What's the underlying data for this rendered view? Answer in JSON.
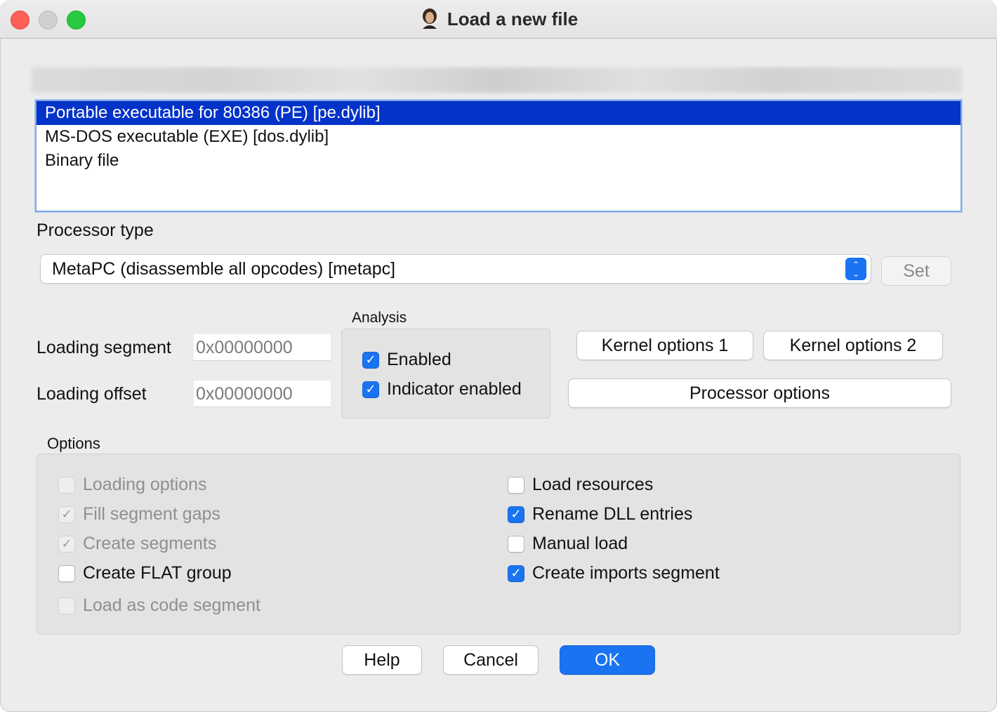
{
  "window": {
    "title": "Load a new file"
  },
  "loaders": [
    {
      "label": "Portable executable for 80386 (PE) [pe.dylib]",
      "selected": true
    },
    {
      "label": "MS-DOS executable (EXE) [dos.dylib]",
      "selected": false
    },
    {
      "label": "Binary file",
      "selected": false
    }
  ],
  "processor": {
    "label": "Processor type",
    "selected": "MetaPC (disassemble all opcodes) [metapc]",
    "set_label": "Set"
  },
  "loading": {
    "segment_label": "Loading segment",
    "segment_value": "0x00000000",
    "offset_label": "Loading offset",
    "offset_value": "0x00000000"
  },
  "analysis": {
    "title": "Analysis",
    "enabled_label": "Enabled",
    "indicator_label": "Indicator enabled"
  },
  "buttons": {
    "kernel1": "Kernel options 1",
    "kernel2": "Kernel options 2",
    "processor_options": "Processor options",
    "help": "Help",
    "cancel": "Cancel",
    "ok": "OK"
  },
  "options": {
    "title": "Options",
    "left": [
      {
        "label": "Loading options",
        "checked": false,
        "disabled": true
      },
      {
        "label": "Fill segment gaps",
        "checked": true,
        "disabled": true
      },
      {
        "label": "Create segments",
        "checked": true,
        "disabled": true
      },
      {
        "label": "Create FLAT group",
        "checked": false,
        "disabled": false
      },
      {
        "label": "Load as code segment",
        "checked": false,
        "disabled": true
      }
    ],
    "right": [
      {
        "label": "Load resources",
        "checked": false,
        "disabled": false
      },
      {
        "label": "Rename DLL entries",
        "checked": true,
        "disabled": false
      },
      {
        "label": "Manual load",
        "checked": false,
        "disabled": false
      },
      {
        "label": "Create imports segment",
        "checked": true,
        "disabled": false
      }
    ]
  },
  "colors": {
    "accent": "#1a73f0",
    "selection": "#0433c9"
  }
}
